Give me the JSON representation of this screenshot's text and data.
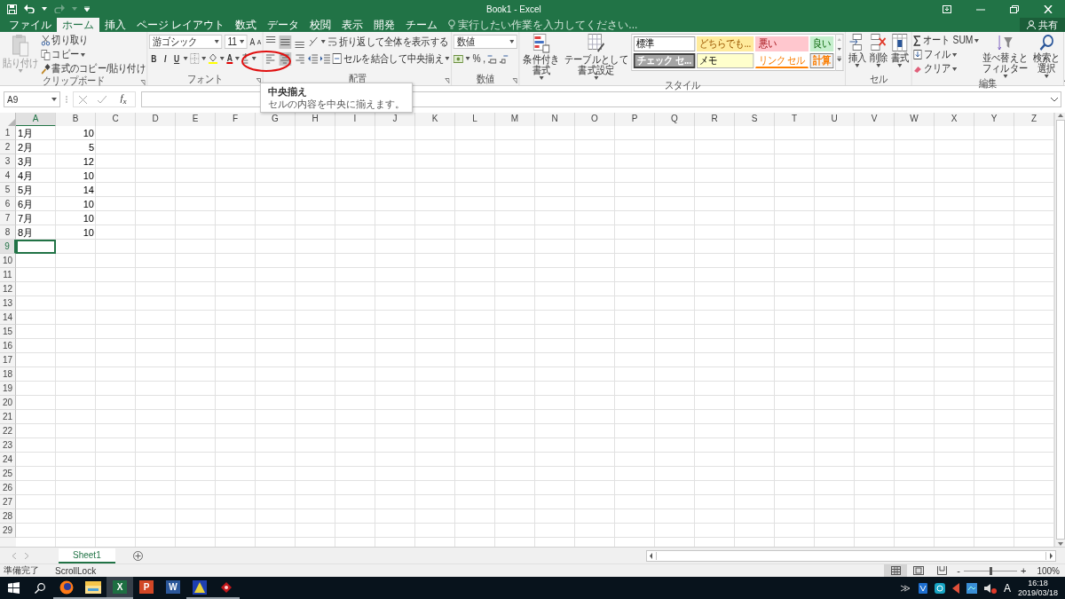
{
  "title_bar": {
    "title": "Book1 - Excel"
  },
  "tabs": [
    {
      "label": "ファイル",
      "selected": false
    },
    {
      "label": "ホーム",
      "selected": true
    },
    {
      "label": "挿入",
      "selected": false
    },
    {
      "label": "ページ レイアウト",
      "selected": false
    },
    {
      "label": "数式",
      "selected": false
    },
    {
      "label": "データ",
      "selected": false
    },
    {
      "label": "校閲",
      "selected": false
    },
    {
      "label": "表示",
      "selected": false
    },
    {
      "label": "開発",
      "selected": false
    },
    {
      "label": "チーム",
      "selected": false
    }
  ],
  "tell_me": {
    "placeholder": "実行したい作業を入力してください..."
  },
  "share": "共有",
  "ribbon": {
    "clipboard": {
      "paste": {
        "label": "貼り付け",
        "disabled": true
      },
      "cut": "切り取り",
      "copy": "コピー",
      "format_painter": "書式のコピー/貼り付け",
      "label": "クリップボード"
    },
    "font": {
      "font_name": "游ゴシック",
      "font_size": "11",
      "grow_font": "A",
      "shrink_font": "A",
      "style_buttons": [
        "B",
        "I",
        "U"
      ],
      "font_color": "A",
      "label": "フォント"
    },
    "alignment": {
      "vertical": [
        {
          "selected": false
        },
        {
          "selected": true
        },
        {
          "selected": false
        }
      ],
      "horizontal": [
        {
          "selected": false
        },
        {
          "selected": true
        },
        {
          "selected": false
        }
      ],
      "wrap_text": "折り返して全体を表示する",
      "merge_center": "セルを結合して中央揃え",
      "label": "配置"
    },
    "number": {
      "format": "数値",
      "percent": "%",
      "comma": ",",
      "label": "数値"
    },
    "styles": {
      "conditional_formatting": "条件付き書式",
      "format_as_table": "テーブルとして書式設定",
      "gallery": [
        {
          "label": "標準",
          "kind": "normal"
        },
        {
          "label": "どちらでも...",
          "kind": "neutral"
        },
        {
          "label": "悪い",
          "kind": "bad"
        },
        {
          "label": "良い",
          "kind": "good"
        },
        {
          "label": "チェック セ...",
          "kind": "check"
        },
        {
          "label": "メモ",
          "kind": "note"
        },
        {
          "label": "リンク セル",
          "kind": "linked"
        },
        {
          "label": "計算",
          "kind": "calculation"
        }
      ],
      "label": "スタイル"
    },
    "cells": {
      "insert": "挿入",
      "delete": "削除",
      "format": "書式",
      "label": "セル"
    },
    "editing": {
      "autosum": "オート SUM",
      "fill": "フィル",
      "clear": "クリア",
      "sort_filter": "並べ替えとフィルター",
      "find_select": "検索と選択",
      "label": "編集"
    }
  },
  "tooltip": {
    "title": "中央揃え",
    "text": "セルの内容を中央に揃えます。"
  },
  "formula_bar": {
    "name_box": "A9",
    "function_label": "f$_{x}$"
  },
  "sheet": {
    "columns": [
      {
        "label": "A",
        "selected": true
      },
      {
        "label": "B",
        "selected": false
      },
      {
        "label": "C",
        "selected": false
      },
      {
        "label": "D",
        "selected": false
      },
      {
        "label": "E",
        "selected": false
      },
      {
        "label": "F",
        "selected": false
      },
      {
        "label": "G",
        "selected": false
      },
      {
        "label": "H",
        "selected": false
      },
      {
        "label": "I",
        "selected": false
      },
      {
        "label": "J",
        "selected": false
      },
      {
        "label": "K",
        "selected": false
      },
      {
        "label": "L",
        "selected": false
      },
      {
        "label": "M",
        "selected": false
      },
      {
        "label": "N",
        "selected": false
      },
      {
        "label": "O",
        "selected": false
      },
      {
        "label": "P",
        "selected": false
      },
      {
        "label": "Q",
        "selected": false
      },
      {
        "label": "R",
        "selected": false
      },
      {
        "label": "S",
        "selected": false
      },
      {
        "label": "T",
        "selected": false
      },
      {
        "label": "U",
        "selected": false
      },
      {
        "label": "V",
        "selected": false
      },
      {
        "label": "W",
        "selected": false
      },
      {
        "label": "X",
        "selected": false
      },
      {
        "label": "Y",
        "selected": false
      },
      {
        "label": "Z",
        "selected": false
      }
    ],
    "rows": [
      {
        "label": "1",
        "selected": false,
        "cells": [
          {
            "text": "1月",
            "kind": "text"
          },
          {
            "text": "10",
            "kind": "number"
          }
        ]
      },
      {
        "label": "2",
        "selected": false,
        "cells": [
          {
            "text": "2月",
            "kind": "text"
          },
          {
            "text": "5",
            "kind": "number"
          }
        ]
      },
      {
        "label": "3",
        "selected": false,
        "cells": [
          {
            "text": "3月",
            "kind": "text"
          },
          {
            "text": "12",
            "kind": "number"
          }
        ]
      },
      {
        "label": "4",
        "selected": false,
        "cells": [
          {
            "text": "4月",
            "kind": "text"
          },
          {
            "text": "10",
            "kind": "number"
          }
        ]
      },
      {
        "label": "5",
        "selected": false,
        "cells": [
          {
            "text": "5月",
            "kind": "text"
          },
          {
            "text": "14",
            "kind": "number"
          }
        ]
      },
      {
        "label": "6",
        "selected": false,
        "cells": [
          {
            "text": "6月",
            "kind": "text"
          },
          {
            "text": "10",
            "kind": "number"
          }
        ]
      },
      {
        "label": "7",
        "selected": false,
        "cells": [
          {
            "text": "7月",
            "kind": "text"
          },
          {
            "text": "10",
            "kind": "number"
          }
        ]
      },
      {
        "label": "8",
        "selected": false,
        "cells": [
          {
            "text": "8月",
            "kind": "text"
          },
          {
            "text": "10",
            "kind": "number"
          }
        ]
      },
      {
        "label": "9",
        "selected": true
      },
      {
        "label": "10",
        "selected": false
      },
      {
        "label": "11",
        "selected": false
      },
      {
        "label": "12",
        "selected": false
      },
      {
        "label": "13",
        "selected": false
      },
      {
        "label": "14",
        "selected": false
      },
      {
        "label": "15",
        "selected": false
      },
      {
        "label": "16",
        "selected": false
      },
      {
        "label": "17",
        "selected": false
      },
      {
        "label": "18",
        "selected": false
      },
      {
        "label": "19",
        "selected": false
      },
      {
        "label": "20",
        "selected": false
      },
      {
        "label": "21",
        "selected": false
      },
      {
        "label": "22",
        "selected": false
      },
      {
        "label": "23",
        "selected": false
      },
      {
        "label": "24",
        "selected": false
      },
      {
        "label": "25",
        "selected": false
      },
      {
        "label": "26",
        "selected": false
      },
      {
        "label": "27",
        "selected": false
      },
      {
        "label": "28",
        "selected": false
      },
      {
        "label": "29",
        "selected": false
      }
    ]
  },
  "sheet_tabs": [
    {
      "label": "Sheet1",
      "selected": true
    }
  ],
  "status_bar": {
    "mode": "準備完了",
    "scroll_lock": "ScrollLock",
    "views": [
      {
        "selected": true
      },
      {
        "selected": false
      },
      {
        "selected": false
      }
    ],
    "zoom_out": "-",
    "zoom_in": "+",
    "zoom": {
      "level": 0.5
    },
    "zoom_label": "100%"
  },
  "taskbar": {
    "apps": [
      {
        "kind": "browser",
        "running": true,
        "active": false
      },
      {
        "kind": "folder",
        "running": true,
        "active": false
      },
      {
        "kind": "excel",
        "glyph": "X",
        "running": true,
        "active": true
      },
      {
        "kind": "powerpoint",
        "glyph": "P",
        "running": false,
        "active": false
      },
      {
        "kind": "word",
        "glyph": "W",
        "running": false,
        "active": false
      },
      {
        "kind": "app-blue",
        "running": true,
        "active": false
      },
      {
        "kind": "app-red",
        "running": true,
        "active": false
      }
    ],
    "ime": "A",
    "time": "16:18",
    "date": "2019/03/18"
  }
}
